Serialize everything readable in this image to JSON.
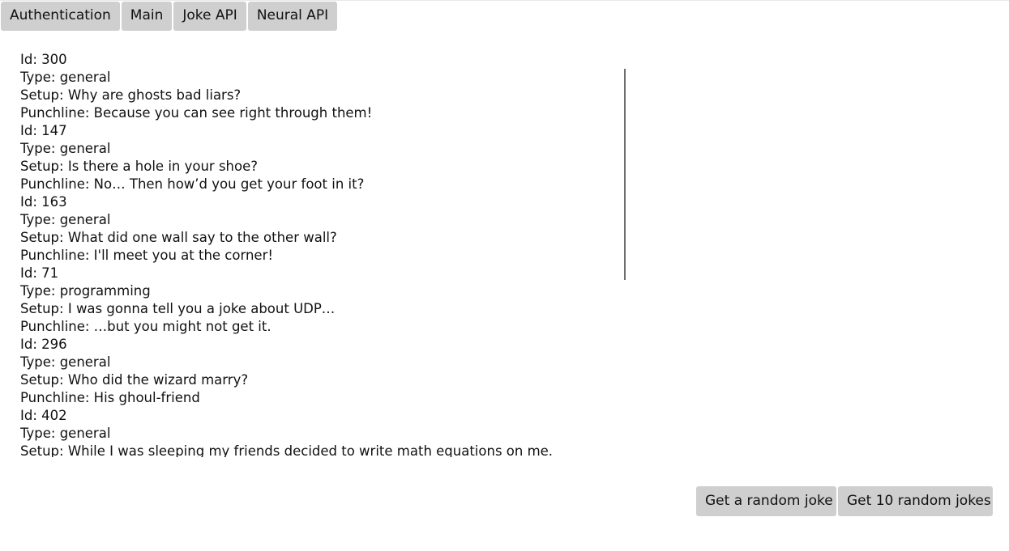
{
  "nav": {
    "tabs": [
      {
        "label": "Authentication"
      },
      {
        "label": "Main"
      },
      {
        "label": "Joke API"
      },
      {
        "label": "Neural API"
      }
    ]
  },
  "jokes": [
    {
      "id": "Id: 300",
      "type": "Type: general",
      "setup": "Setup: Why are ghosts bad liars?",
      "punchline": "Punchline: Because you can see right through them!"
    },
    {
      "id": "Id: 147",
      "type": "Type: general",
      "setup": "Setup: Is there a hole in your shoe?",
      "punchline": "Punchline: No… Then how’d you get your foot in it?"
    },
    {
      "id": "Id: 163",
      "type": "Type: general",
      "setup": "Setup: What did one wall say to the other wall?",
      "punchline": "Punchline: I'll meet you at the corner!"
    },
    {
      "id": "Id: 71",
      "type": "Type: programming",
      "setup": "Setup: I was gonna tell you a joke about UDP…",
      "punchline": "Punchline: …but you might not get it."
    },
    {
      "id": "Id: 296",
      "type": "Type: general",
      "setup": "Setup: Who did the wizard marry?",
      "punchline": "Punchline: His ghoul-friend"
    },
    {
      "id": "Id: 402",
      "type": "Type: general",
      "setup": "Setup: While I was sleeping my friends decided to write math equations on me.",
      "punchline": ""
    }
  ],
  "actions": {
    "random_joke_label": "Get a random joke",
    "ten_jokes_label": "Get 10 random jokes"
  }
}
